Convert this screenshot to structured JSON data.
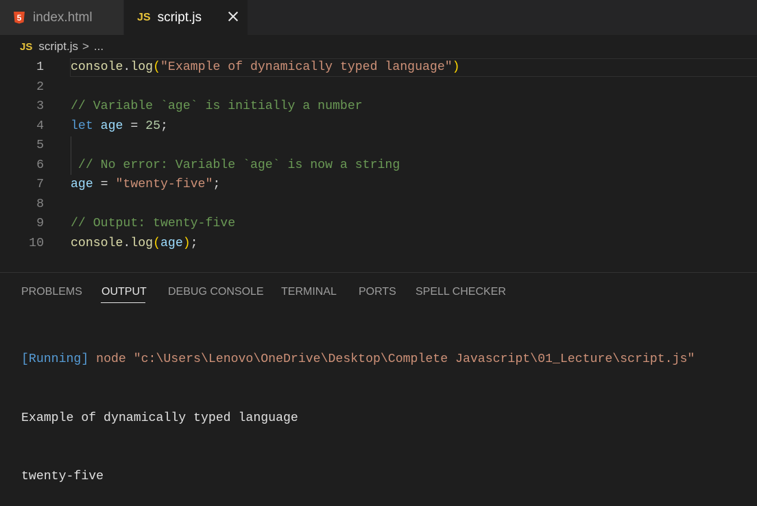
{
  "tabs": [
    {
      "icon": "html5-icon",
      "icon_text": "5",
      "label": "index.html",
      "active": false
    },
    {
      "icon": "javascript-icon",
      "icon_text": "JS",
      "label": "script.js",
      "active": true
    }
  ],
  "breadcrumb": {
    "icon_text": "JS",
    "file": "script.js",
    "separator": ">",
    "ellipsis": "..."
  },
  "editor": {
    "current_line": 1,
    "lines": [
      {
        "no": "1",
        "tokens": [
          [
            "fn",
            "console"
          ],
          [
            "id",
            "."
          ],
          [
            "fn",
            "log"
          ],
          [
            "br",
            "("
          ],
          [
            "str",
            "\"Example of dynamically typed language\""
          ],
          [
            "br",
            ")"
          ]
        ]
      },
      {
        "no": "2",
        "tokens": []
      },
      {
        "no": "3",
        "tokens": [
          [
            "cm",
            "// Variable `age` is initially a number"
          ]
        ]
      },
      {
        "no": "4",
        "tokens": [
          [
            "kw",
            "let"
          ],
          [
            "id",
            " "
          ],
          [
            "vr",
            "age"
          ],
          [
            "id",
            " = "
          ],
          [
            "num",
            "25"
          ],
          [
            "id",
            ";"
          ]
        ]
      },
      {
        "no": "5",
        "tokens": []
      },
      {
        "no": "6",
        "tokens": [
          [
            "cm",
            " // No error: Variable `age` is now a string"
          ]
        ]
      },
      {
        "no": "7",
        "tokens": [
          [
            "vr",
            "age"
          ],
          [
            "id",
            " = "
          ],
          [
            "str",
            "\"twenty-five\""
          ],
          [
            "id",
            ";"
          ]
        ]
      },
      {
        "no": "8",
        "tokens": []
      },
      {
        "no": "9",
        "tokens": [
          [
            "cm",
            "// Output: twenty-five"
          ]
        ]
      },
      {
        "no": "10",
        "tokens": [
          [
            "fn",
            "console"
          ],
          [
            "id",
            "."
          ],
          [
            "fn",
            "log"
          ],
          [
            "br",
            "("
          ],
          [
            "vr",
            "age"
          ],
          [
            "br",
            ")"
          ],
          [
            "id",
            ";"
          ]
        ]
      }
    ]
  },
  "panel": {
    "tabs": [
      "PROBLEMS",
      "OUTPUT",
      "DEBUG CONSOLE",
      "TERMINAL",
      "PORTS",
      "SPELL CHECKER"
    ],
    "active_tab": "OUTPUT",
    "output": {
      "running_tag": "[Running]",
      "command": " node \"c:\\Users\\Lenovo\\OneDrive\\Desktop\\Complete Javascript\\01_Lecture\\script.js\"",
      "lines": [
        "Example of dynamically typed language",
        "twenty-five"
      ]
    }
  },
  "colors": {
    "background": "#1e1e1e",
    "tabbar": "#252526",
    "keyword": "#569cd6",
    "string": "#ce9178",
    "comment": "#6a9955",
    "function": "#dcdcaa",
    "number": "#b5cea8",
    "variable": "#9cdcfe",
    "bracket": "#ffd700"
  }
}
